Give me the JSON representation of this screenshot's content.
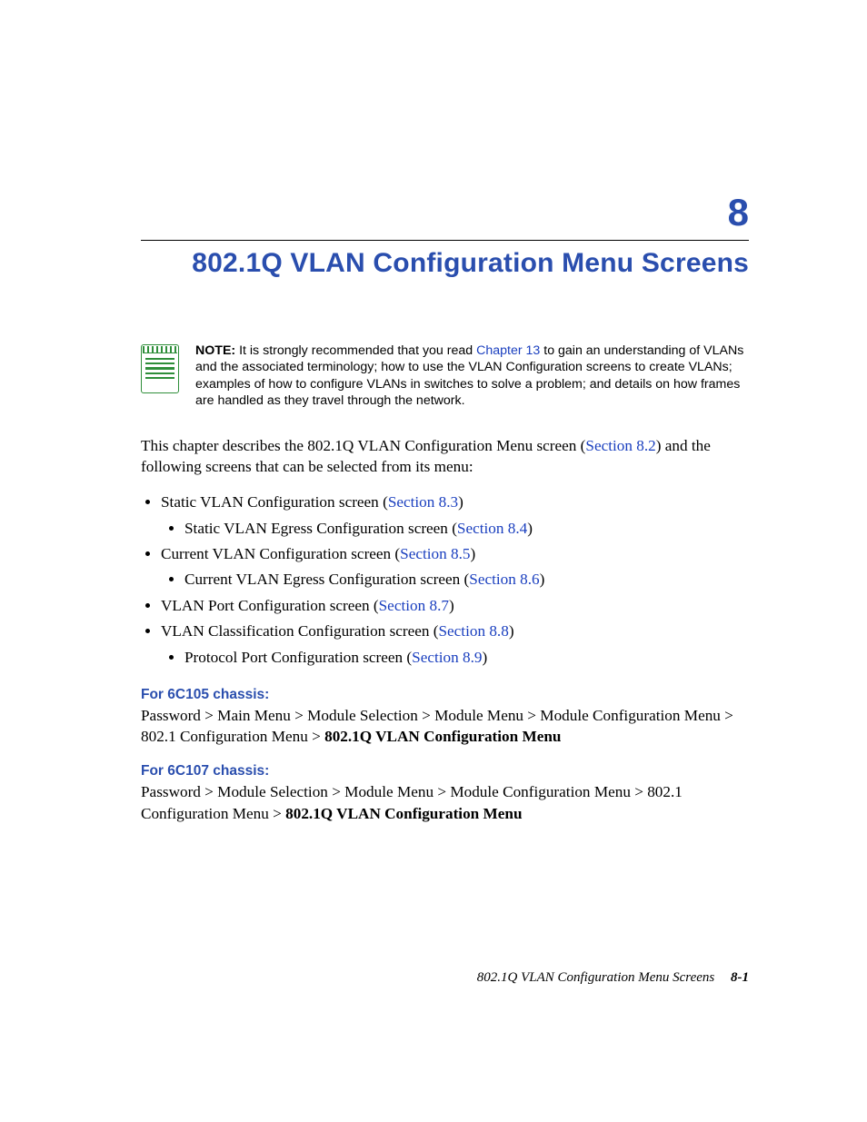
{
  "chapter": {
    "number": "8",
    "title": "802.1Q VLAN Configuration Menu Screens"
  },
  "note": {
    "label": "NOTE:",
    "pre": " It is strongly recommended that you read ",
    "link": "Chapter 13",
    "post": " to gain an understanding of VLANs and the associated terminology; how to use the VLAN Configuration screens to create VLANs; examples of how to configure VLANs in switches to solve a problem; and details on how frames are handled as they travel through the network."
  },
  "intro": {
    "pre": "This chapter describes the 802.1Q VLAN Configuration Menu screen (",
    "link": "Section 8.2",
    "post": ") and the following screens that can be selected from its menu:"
  },
  "toc": [
    {
      "text": "Static VLAN Configuration screen (",
      "link": "Section 8.3",
      "after": ")",
      "children": [
        {
          "text": "Static VLAN Egress Configuration screen (",
          "link": "Section 8.4",
          "after": ")"
        }
      ]
    },
    {
      "text": "Current VLAN Configuration screen (",
      "link": "Section 8.5",
      "after": ")",
      "children": [
        {
          "text": "Current VLAN Egress Configuration screen (",
          "link": "Section 8.6",
          "after": ")"
        }
      ]
    },
    {
      "text": "VLAN Port Configuration screen (",
      "link": "Section 8.7",
      "after": ")"
    },
    {
      "text": "VLAN Classification Configuration screen (",
      "link": "Section 8.8",
      "after": ")",
      "children": [
        {
          "text": "Protocol Port Configuration screen (",
          "link": "Section 8.9",
          "after": ")"
        }
      ]
    }
  ],
  "paths": {
    "p1": {
      "heading": "For 6C105 chassis:",
      "crumb": "Password > Main Menu > Module Selection > Module Menu > Module Configuration Menu > 802.1 Configuration Menu > ",
      "bold": "802.1Q VLAN Configuration Menu"
    },
    "p2": {
      "heading": "For 6C107 chassis:",
      "crumb": "Password > Module Selection > Module Menu > Module Configuration Menu > 802.1 Configuration Menu > ",
      "bold": "802.1Q VLAN Configuration Menu"
    }
  },
  "footer": {
    "title": "802.1Q VLAN Configuration Menu Screens",
    "page": "8-1"
  }
}
